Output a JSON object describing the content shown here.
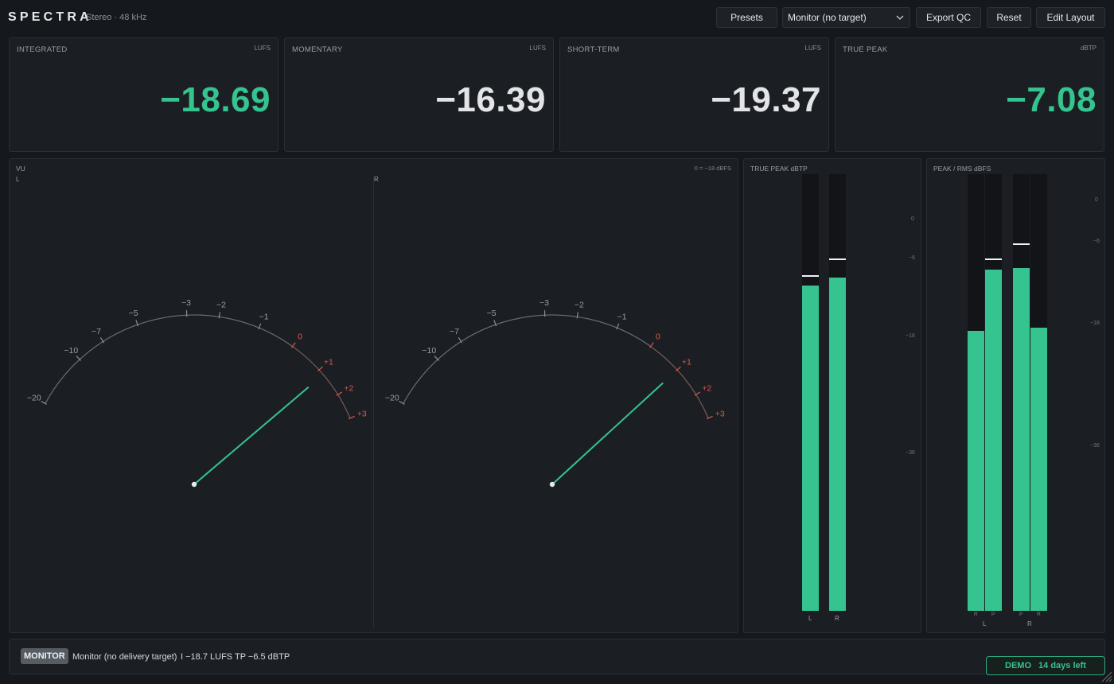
{
  "app": {
    "name": "SPECTRA",
    "subtitle": "Stereo · 48 kHz"
  },
  "toolbar": {
    "presets_label": "Presets",
    "target_select": {
      "value": "Monitor (no target)",
      "icon": "chevron-down-icon"
    },
    "export_label": "Export QC",
    "reset_label": "Reset",
    "edit_layout_label": "Edit Layout"
  },
  "cards": [
    {
      "label": "INTEGRATED",
      "unit": "LUFS",
      "value": "−18.69",
      "highlight": true
    },
    {
      "label": "MOMENTARY",
      "unit": "LUFS",
      "value": "−16.39",
      "highlight": false
    },
    {
      "label": "SHORT-TERM",
      "unit": "LUFS",
      "value": "−19.37",
      "highlight": false
    },
    {
      "label": "TRUE PEAK",
      "unit": "dBTP",
      "value": "−7.08",
      "highlight": true
    }
  ],
  "vu": {
    "title": "VU",
    "reference": "0 = −18 dBFS",
    "channels": [
      {
        "label": "L",
        "needle_vu": 1.2
      },
      {
        "label": "R",
        "needle_vu": 1.0
      }
    ],
    "scale": [
      "−20",
      "−10",
      "−7",
      "−5",
      "−3",
      "−2",
      "−1",
      "0",
      "+1",
      "+2",
      "+3"
    ],
    "colors": {
      "needle": "#35c48f",
      "red_zone": "#e0564a"
    }
  },
  "true_peak_meter": {
    "title": "TRUE PEAK dBTP",
    "scale": [
      "0",
      "−6",
      "−18",
      "−36"
    ],
    "channels": [
      {
        "label": "L",
        "level": 0.745,
        "hold": 0.765
      },
      {
        "label": "R",
        "level": 0.763,
        "hold": 0.803
      }
    ]
  },
  "peak_rms_meter": {
    "title": "PEAK / RMS dBFS",
    "scale": [
      "0",
      "−6",
      "−18",
      "−36"
    ],
    "groups": [
      {
        "label": "L",
        "bars": [
          {
            "label": "R",
            "level": 0.642,
            "hold": null
          },
          {
            "label": "P",
            "level": 0.781,
            "hold": 0.803
          }
        ]
      },
      {
        "label": "R",
        "bars": [
          {
            "label": "P",
            "level": 0.786,
            "hold": 0.838
          },
          {
            "label": "R",
            "level": 0.648,
            "hold": null
          }
        ]
      }
    ]
  },
  "footer": {
    "mode": "MONITOR",
    "target_text": "Monitor (no delivery target)",
    "integrated_text": "I −18.7 LUFS",
    "true_peak_text": "TP −6.5 dBTP",
    "demo_label": "DEMO",
    "demo_remaining": "14 days left"
  },
  "colors": {
    "accent": "#35c48f",
    "background": "#15181c",
    "panel": "#1b1f24"
  }
}
